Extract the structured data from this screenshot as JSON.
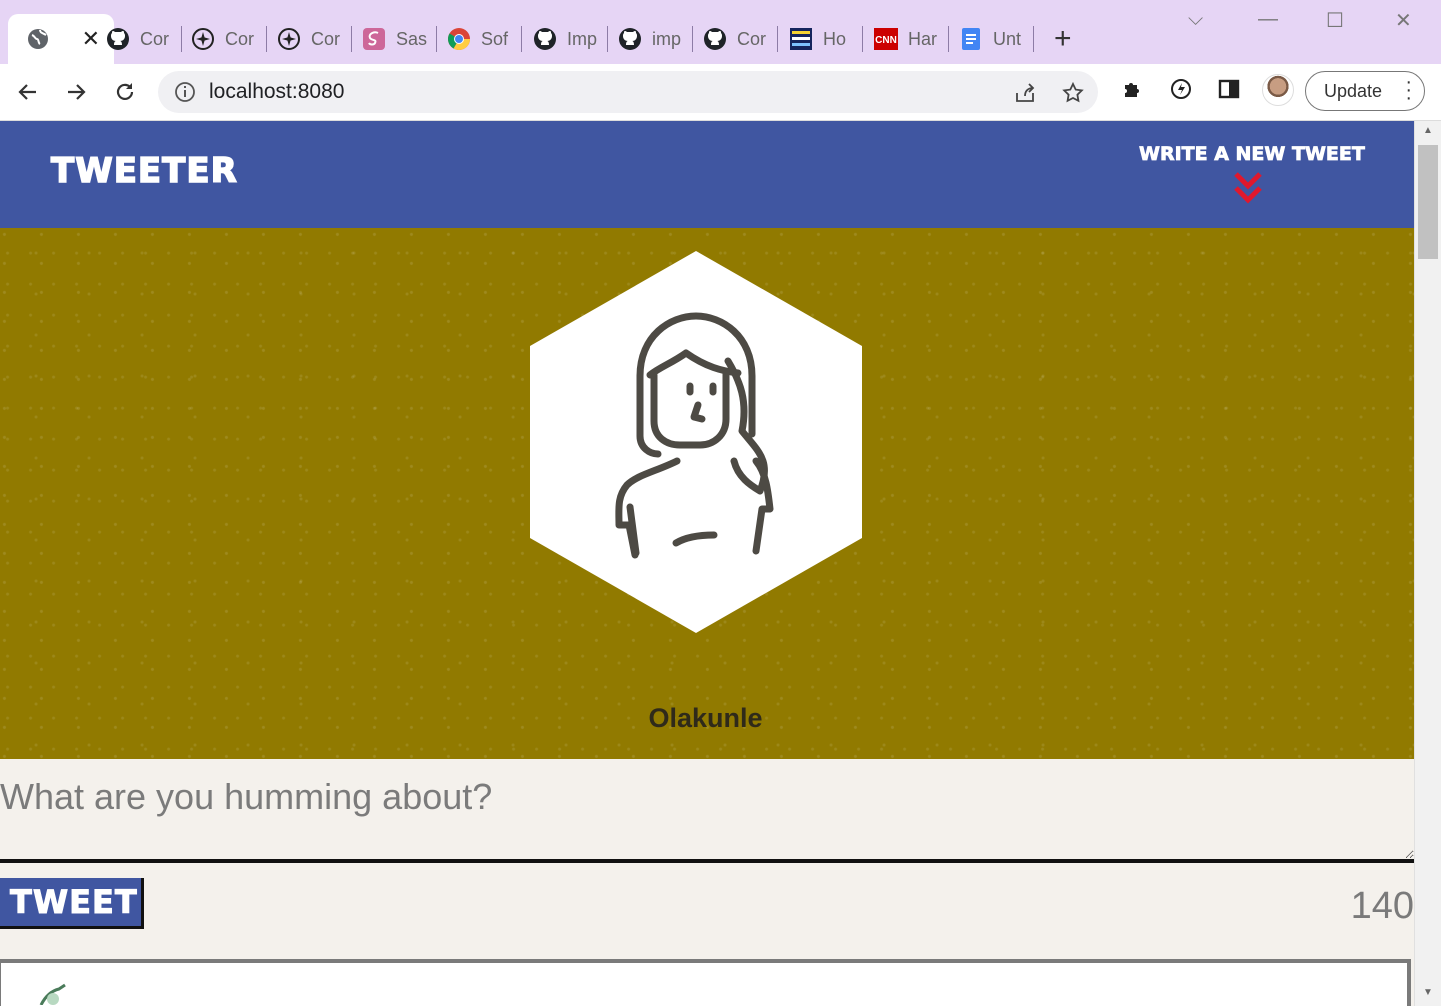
{
  "browser": {
    "tabs": [
      {
        "label": "",
        "icon": "globe-icon",
        "active": true
      },
      {
        "label": "Cor",
        "icon": "github-icon"
      },
      {
        "label": "Cor",
        "icon": "compass-icon"
      },
      {
        "label": "Cor",
        "icon": "compass-icon"
      },
      {
        "label": "Sas",
        "icon": "sass-icon"
      },
      {
        "label": "Sof",
        "icon": "chrome-icon"
      },
      {
        "label": "Imp",
        "icon": "github-icon"
      },
      {
        "label": "imp",
        "icon": "github-icon"
      },
      {
        "label": "Cor",
        "icon": "github-icon"
      },
      {
        "label": "Ho",
        "icon": "site-wizard-icon"
      },
      {
        "label": "Har",
        "icon": "cnn-icon"
      },
      {
        "label": "Unt",
        "icon": "docs-icon"
      }
    ],
    "url": "localhost:8080",
    "update_label": "Update",
    "accent": "#e6d5f5"
  },
  "nav": {
    "brand": "TWEETER",
    "compose_link": "WRITE A NEW TWEET",
    "color": "#4056a1"
  },
  "profile": {
    "name": "Olakunle",
    "avatar_icon": "person-avatar-icon",
    "banner_color": "#917a00"
  },
  "composer": {
    "placeholder": "What are you humming about?",
    "submit_label": "TWEET",
    "counter": "140"
  }
}
